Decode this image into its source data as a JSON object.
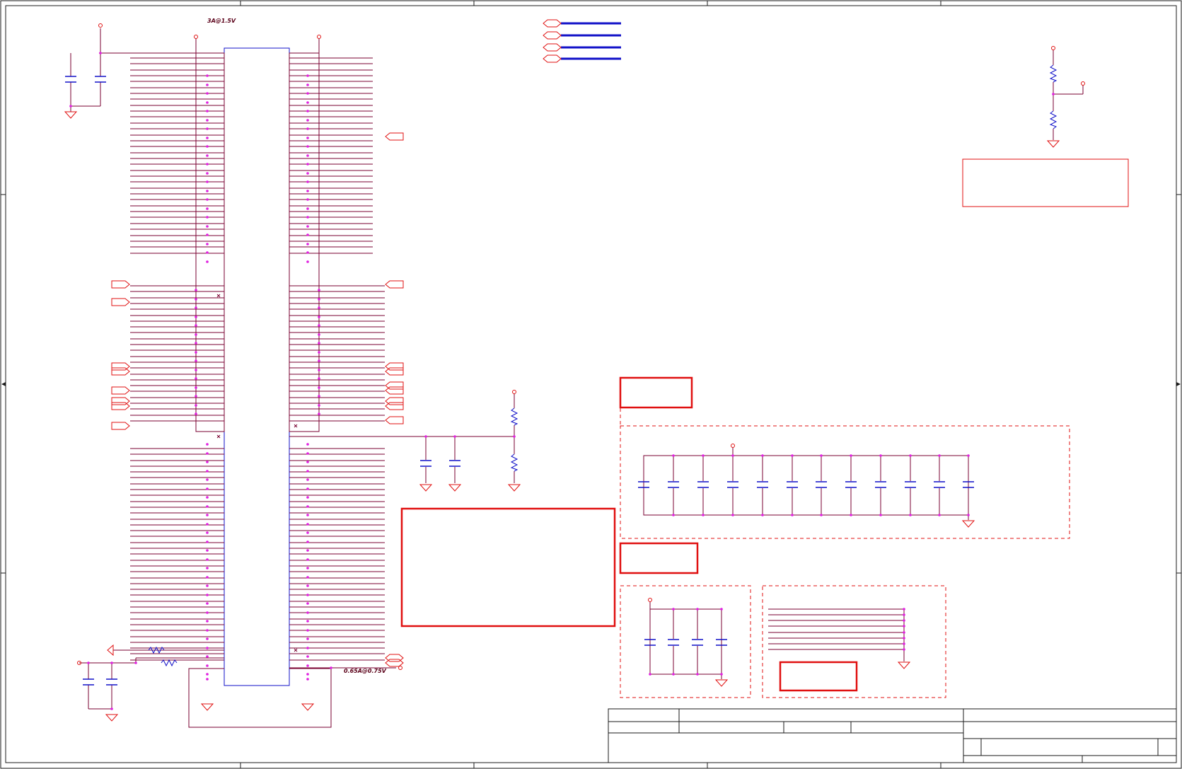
{
  "labels": {
    "rail_top": "3A@1.5V",
    "rail_bottom": "0.65A@0.75V"
  },
  "colors": {
    "background": "#ffffff",
    "frame": "#1a1a1a",
    "wire": "#7a0030",
    "bus": "#1010c8",
    "component": "#1010c8",
    "port": "#e01010",
    "junction": "#e020e0",
    "note_box": "#e01010"
  },
  "icons": {
    "port": "hexagon-port-icon",
    "ground": "ground-triangle-icon",
    "power": "power-pin-circle-icon",
    "capacitor": "capacitor-icon",
    "resistor": "resistor-zigzag-icon"
  }
}
